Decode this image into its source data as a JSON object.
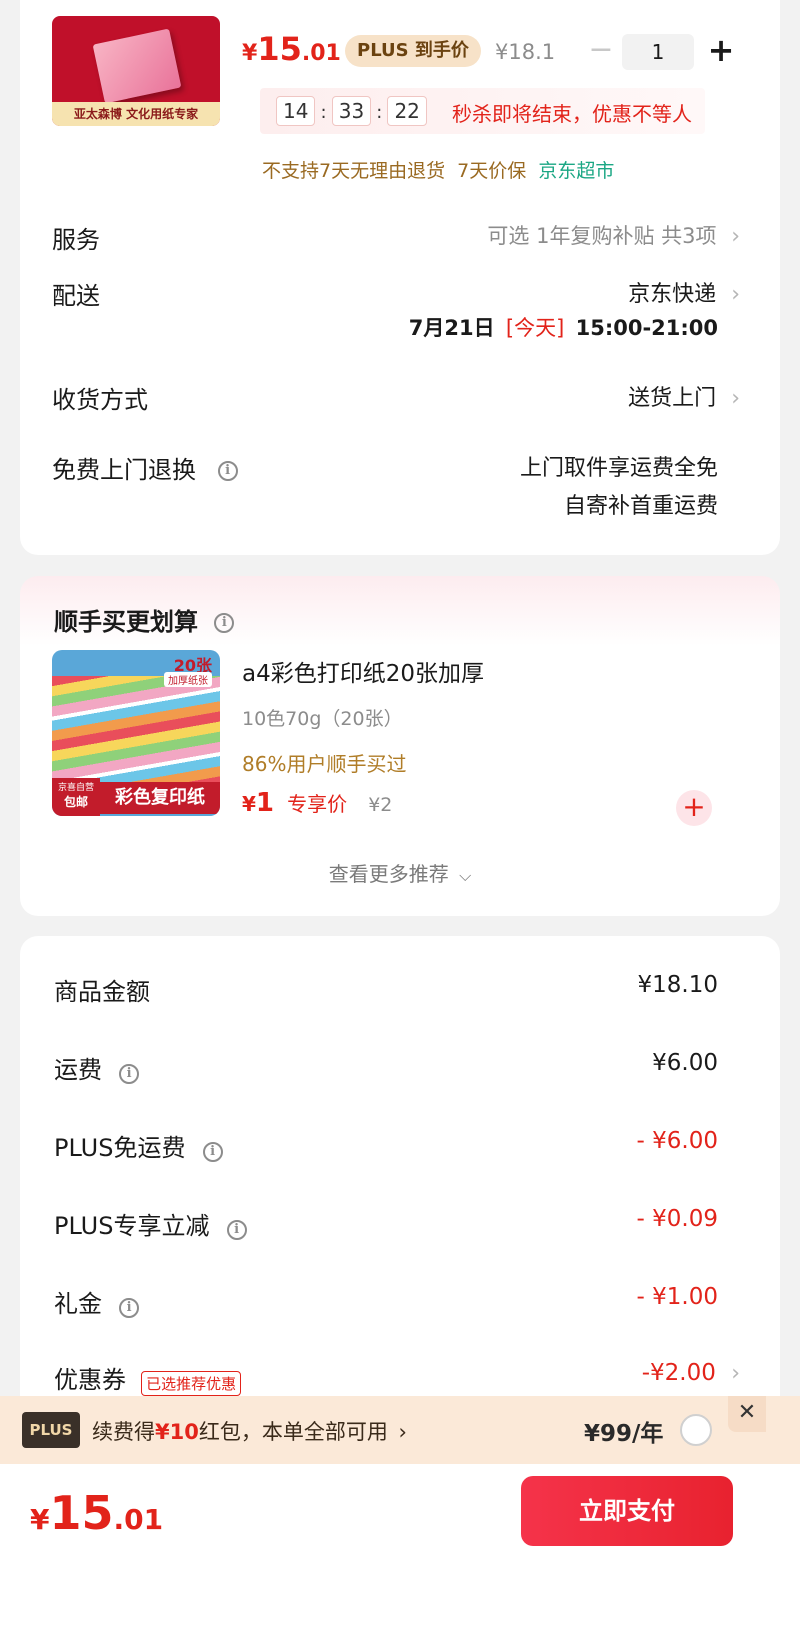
{
  "product": {
    "brand_caption": "亚太森博 文化用纸专家",
    "price_symbol": "¥",
    "price_int": "15",
    "price_dec": ".01",
    "plus_badge_text": "PLUS 到手价",
    "original_price": "¥18.1",
    "quantity": "1",
    "countdown": {
      "h": "14",
      "m": "33",
      "s": "22",
      "sep": ":"
    },
    "countdown_text": "秒杀即将结束，优惠不等人",
    "policy_text": "不支持7天无理由退货  7天价保",
    "store_name": "京东超市"
  },
  "service_rows": {
    "service": {
      "label": "服务",
      "value": "可选 1年复购补贴 共3项"
    },
    "delivery": {
      "label": "配送",
      "value": "京东快递",
      "date": "7月21日",
      "today_tag": "[今天]",
      "time_window": "15:00-21:00"
    },
    "receive": {
      "label": "收货方式",
      "value": "送货上门"
    },
    "free_return": {
      "label": "免费上门退换",
      "line1": "上门取件享运费全免",
      "line2": "自寄补首重运费"
    }
  },
  "recommend": {
    "title": "顺手买更划算",
    "item": {
      "thumb_badge": "20张",
      "thumb_sub": "加厚纸张",
      "thumb_corner_1": "京喜自营",
      "thumb_corner_2": "包邮",
      "thumb_caption": "彩色复印纸",
      "name": "a4彩色打印纸20张加厚",
      "spec": "10色70g（20张）",
      "social_proof": "86%用户顺手买过",
      "price_symbol": "¥",
      "price": "1",
      "price_tag": "专享价",
      "original": "¥2"
    },
    "more_link": "查看更多推荐"
  },
  "summary": {
    "rows": [
      {
        "label": "商品金额",
        "value": "¥18.10",
        "info": false
      },
      {
        "label": "运费",
        "value": "¥6.00",
        "info": true
      },
      {
        "label": "PLUS免运费",
        "value": "- ¥6.00",
        "info": true
      },
      {
        "label": "PLUS专享立减",
        "value": "- ¥0.09",
        "info": true
      },
      {
        "label": "礼金",
        "value": "- ¥1.00",
        "info": true
      }
    ],
    "coupon": {
      "label": "优惠券",
      "tag": "已选推荐优惠",
      "value": "-¥2.00"
    }
  },
  "plus_banner": {
    "logo": "PLUS",
    "text_prefix": "续费得",
    "text_amount": "¥10",
    "text_suffix": "红包，本单全部可用",
    "arrow": "›",
    "price": "¥99/年"
  },
  "footer": {
    "total_symbol": "¥",
    "total_int": "15",
    "total_dec": ".01",
    "pay_button": "立即支付"
  },
  "colors": {
    "accent_red": "#e2231a",
    "plus_gold": "#8a5a14",
    "store_green": "#1ba784",
    "pay_gradient_start": "#f5334a",
    "pay_gradient_end": "#e8222f"
  }
}
